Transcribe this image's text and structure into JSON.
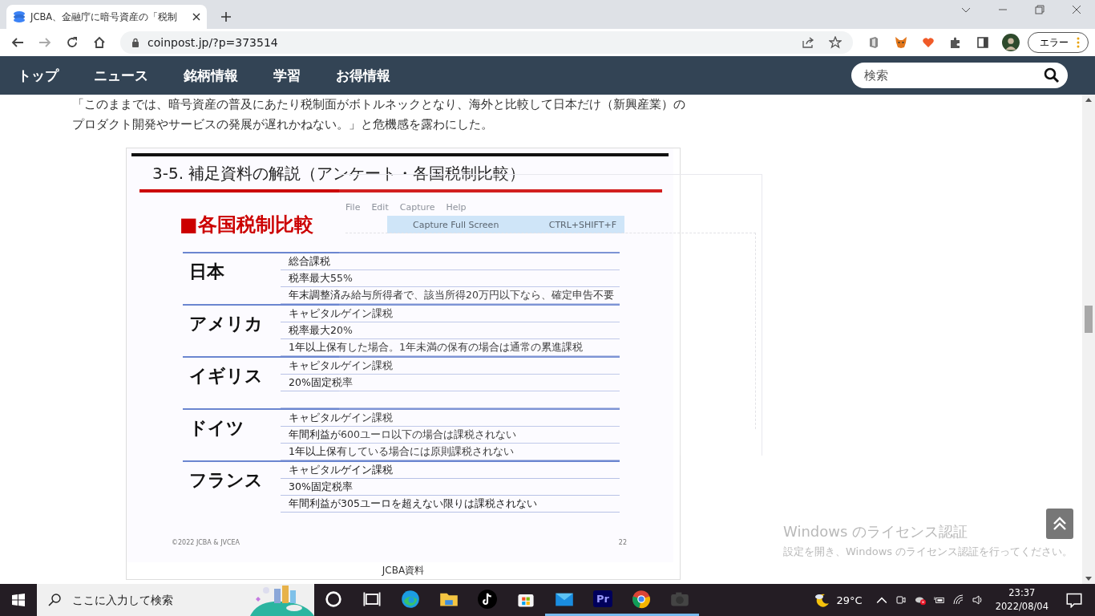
{
  "browser": {
    "tab": {
      "title": "JCBA、金融庁に暗号資産の「税制",
      "selected": true
    },
    "address": "coinpost.jp/?p=373514",
    "profile_button": "エラー"
  },
  "site_nav": {
    "items": [
      "トップ",
      "ニュース",
      "銘柄情報",
      "学習",
      "お得情報"
    ],
    "search": {
      "placeholder": "検索"
    }
  },
  "article": {
    "paragraph_lines": [
      "「このままでは、暗号資産の普及にあたり税制面がボトルネックとなり、海外と比較して日本だけ（新興産業）の",
      "プロダクト開発やサービスの発展が遅れかねない。」と危機感を露わにした。"
    ],
    "slide": {
      "title": "3-5. 補足資料の解説（アンケート・各国税制比較）",
      "heading": "■各国税制比較",
      "countries": [
        {
          "name": "日本",
          "items": [
            "総合課税",
            "税率最大55%",
            "年末調整済み給与所得者で、該当所得20万円以下なら、確定申告不要"
          ]
        },
        {
          "name": "アメリカ",
          "items": [
            "キャピタルゲイン課税",
            "税率最大20%",
            "1年以上保有した場合。1年未満の保有の場合は通常の累進課税"
          ]
        },
        {
          "name": "イギリス",
          "items": [
            "キャピタルゲイン課税",
            "20%固定税率"
          ]
        },
        {
          "name": "ドイツ",
          "items": [
            "キャピタルゲイン課税",
            "年間利益が600ユーロ以下の場合は課税されない",
            "1年以上保有している場合には原則課税されない"
          ]
        },
        {
          "name": "フランス",
          "items": [
            "キャピタルゲイン課税",
            "30%固定税率",
            "年間利益が305ユーロを超えない限りは課税されない"
          ]
        }
      ],
      "footer": "©2022 JCBA & JVCEA",
      "page": "22"
    },
    "caption": "JCBA資料"
  },
  "snapshot": {
    "menus": [
      "File",
      "Edit",
      "Capture",
      "Help"
    ],
    "menu_item": {
      "label": "Capture Full Screen",
      "shortcut": "CTRL+SHIFT+F",
      "selected": true
    }
  },
  "windows_notice": {
    "title": "Windows のライセンス認証",
    "text": "設定を開き、Windows のライセンス認証を行ってください。"
  },
  "taskbar": {
    "search_placeholder": "ここに入力して検索",
    "apps": [
      {
        "kind": "cortana",
        "running": false
      },
      {
        "kind": "taskview",
        "running": false
      },
      {
        "kind": "edge",
        "running": false
      },
      {
        "kind": "explorer",
        "running": false
      },
      {
        "kind": "tiktok",
        "running": false
      },
      {
        "kind": "store",
        "running": false
      },
      {
        "kind": "mail",
        "running": true
      },
      {
        "kind": "premiere",
        "label": "Pr",
        "running": true
      },
      {
        "kind": "chrome",
        "running": true
      },
      {
        "kind": "camera",
        "running": true
      }
    ],
    "temperature": "29°C",
    "time": "23:37",
    "date": "2022/08/04"
  }
}
